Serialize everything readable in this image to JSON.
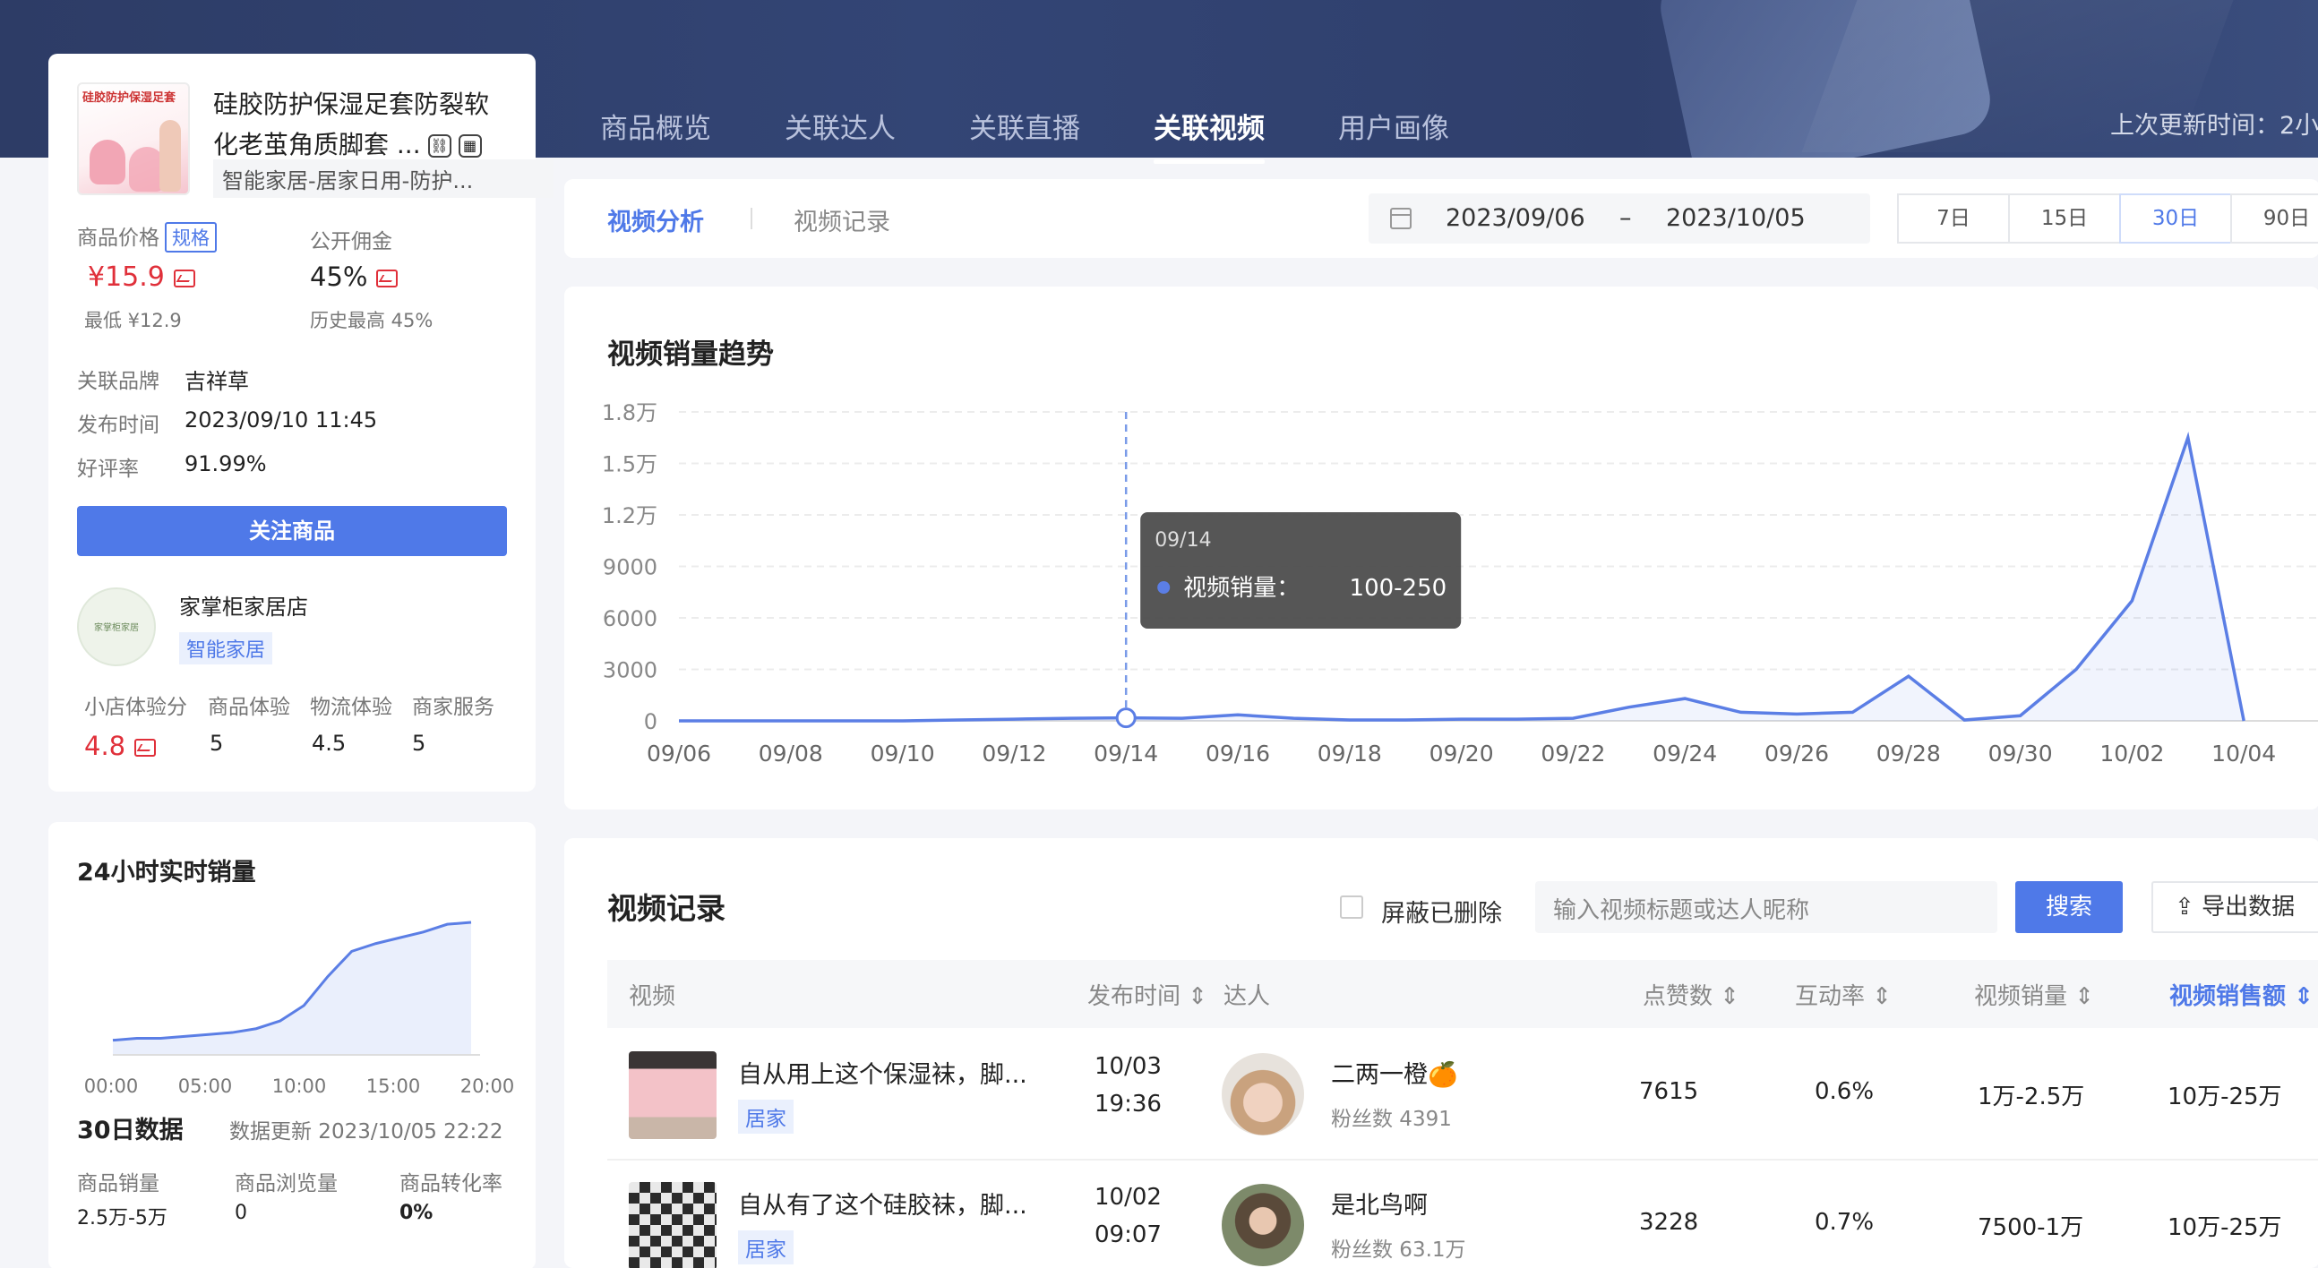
{
  "header": {
    "nav": [
      "商品概览",
      "关联达人",
      "关联直播",
      "关联视频",
      "用户画像"
    ],
    "active_nav": 3,
    "update_text": "上次更新时间：2小"
  },
  "product": {
    "thumb_text": "硅胶防护保湿足套",
    "title_line1": "硅胶防护保湿足套防裂软",
    "title_line2": "化老茧角质脚套 ...",
    "category": "智能家居-居家日用-防护...",
    "price_label": "商品价格",
    "spec_tag": "规格",
    "price": "¥15.9",
    "price_min": "最低 ¥12.9",
    "commission_label": "公开佣金",
    "commission": "45%",
    "commission_max": "历史最高 45%",
    "brand_label": "关联品牌",
    "brand": "吉祥草",
    "publish_label": "发布时间",
    "publish": "2023/09/10 11:45",
    "rating_label": "好评率",
    "rating": "91.99%",
    "follow_button": "关注商品"
  },
  "shop": {
    "logo_text": "家掌柜家居",
    "name": "家掌柜家居店",
    "tag": "智能家居",
    "scores": [
      {
        "label": "小店体验分",
        "value": "4.8"
      },
      {
        "label": "商品体验",
        "value": "5"
      },
      {
        "label": "物流体验",
        "value": "4.5"
      },
      {
        "label": "商家服务",
        "value": "5"
      }
    ]
  },
  "realtime": {
    "title": "24小时实时销量",
    "ticks": [
      "00:00",
      "05:00",
      "10:00",
      "15:00",
      "20:00"
    ],
    "values": [
      2,
      3,
      3,
      4,
      5,
      6,
      8,
      12,
      20,
      35,
      48,
      52,
      55,
      58,
      62,
      63
    ]
  },
  "data30": {
    "title": "30日数据",
    "update": "数据更新 2023/10/05 22:22",
    "items": [
      {
        "label": "商品销量",
        "value": "2.5万-5万"
      },
      {
        "label": "商品浏览量",
        "value": "0"
      },
      {
        "label": "商品转化率",
        "value": "0%"
      }
    ]
  },
  "toolbar": {
    "tabs": [
      "视频分析",
      "视频记录"
    ],
    "date_start": "2023/09/06",
    "date_sep": "–",
    "date_end": "2023/10/05",
    "ranges": [
      "7日",
      "15日",
      "30日",
      "90日"
    ],
    "active_range": 2
  },
  "chart_data": {
    "type": "line",
    "title": "视频销量趋势",
    "x": [
      "09/06",
      "09/07",
      "09/08",
      "09/09",
      "09/10",
      "09/11",
      "09/12",
      "09/13",
      "09/14",
      "09/15",
      "09/16",
      "09/17",
      "09/18",
      "09/19",
      "09/20",
      "09/21",
      "09/22",
      "09/23",
      "09/24",
      "09/25",
      "09/26",
      "09/27",
      "09/28",
      "09/29",
      "09/30",
      "10/01",
      "10/02",
      "10/03",
      "10/04",
      "10/05"
    ],
    "x_ticks": [
      "09/06",
      "09/08",
      "09/10",
      "09/12",
      "09/14",
      "09/16",
      "09/18",
      "09/20",
      "09/22",
      "09/24",
      "09/26",
      "09/28",
      "09/30",
      "10/02",
      "10/04"
    ],
    "series": [
      {
        "values": [
          0,
          0,
          0,
          0,
          0,
          50,
          100,
          150,
          175,
          150,
          350,
          150,
          50,
          50,
          100,
          100,
          150,
          800,
          1300,
          500,
          400,
          500,
          2600,
          50,
          300,
          3000,
          7000,
          16500,
          0
        ]
      }
    ],
    "y_ticks": [
      "0",
      "3000",
      "6000",
      "9000",
      "1.2万",
      "1.5万",
      "1.8万"
    ],
    "ylim": [
      0,
      18000
    ],
    "grid": true,
    "tooltip": {
      "date": "09/14",
      "label": "视频销量：",
      "value": "100-250"
    }
  },
  "records": {
    "title": "视频记录",
    "hide_deleted": "屏蔽已删除",
    "search_placeholder": "输入视频标题或达人昵称",
    "search_button": "搜索",
    "export_button": "导出数据",
    "columns": [
      "视频",
      "发布时间",
      "达人",
      "点赞数",
      "互动率",
      "视频销量",
      "视频销售额"
    ],
    "rows": [
      {
        "title": "自从用上这个保湿袜，脚...",
        "tag": "居家",
        "date": "10/03",
        "time": "19:36",
        "name": "二两一橙🍊",
        "fans": "粉丝数 4391",
        "likes": "7615",
        "rate": "0.6%",
        "sales": "1万-2.5万",
        "revenue": "10万-25万"
      },
      {
        "title": "自从有了这个硅胶袜，脚...",
        "tag": "居家",
        "date": "10/02",
        "time": "09:07",
        "name": "是北鸟啊",
        "fans": "粉丝数 63.1万",
        "likes": "3228",
        "rate": "0.7%",
        "sales": "7500-1万",
        "revenue": "10万-25万"
      }
    ]
  }
}
